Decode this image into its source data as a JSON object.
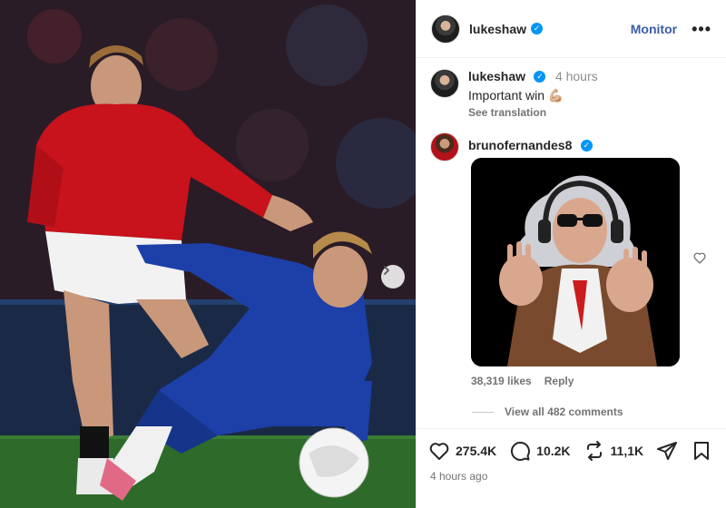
{
  "post": {
    "username": "lukeshaw",
    "follow_label": "Monitor",
    "more_label": "•••",
    "caption": {
      "username": "lukeshaw",
      "time": "4 hours",
      "text": "Important win 💪🏼",
      "see_translation": "See translation"
    },
    "comment": {
      "username": "brunofernandes8",
      "likes": "38,319 likes",
      "reply": "Reply"
    },
    "view_all_comments": "View all 482 comments",
    "stats": {
      "likes": "275.4K",
      "comments": "10.2K",
      "reposts": "11,1K"
    },
    "posted": "4 hours ago"
  },
  "icons": {
    "verified": "verified-badge-icon",
    "next": "chevron-right-icon",
    "heart": "heart-icon",
    "comment": "comment-icon",
    "repost": "repost-icon",
    "share": "share-icon",
    "save": "bookmark-icon"
  },
  "colors": {
    "accent": "#0095f6",
    "follow": "#3b5ba8",
    "muted": "#737373"
  }
}
